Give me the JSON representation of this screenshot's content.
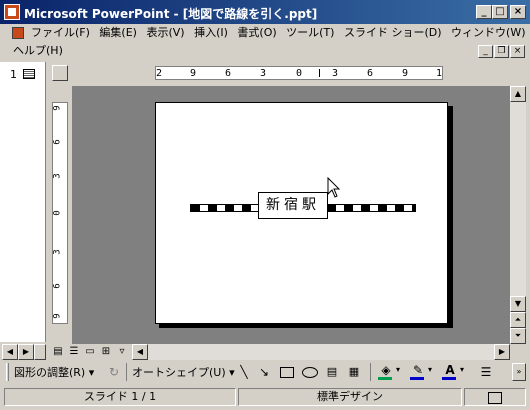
{
  "window": {
    "title": "Microsoft PowerPoint - [地図で路線を引く.ppt]",
    "controls": {
      "minimize": "_",
      "maximize": "□",
      "close": "×"
    }
  },
  "menu": {
    "items": [
      "ファイル(F)",
      "編集(E)",
      "表示(V)",
      "挿入(I)",
      "書式(O)",
      "ツール(T)",
      "スライド ショー(D)",
      "ウィンドウ(W)",
      "ヘルプ(H)"
    ],
    "doc_controls": {
      "minimize": "_",
      "restore": "❐",
      "close": "×"
    }
  },
  "thumbnails": {
    "slide_number": "1"
  },
  "ruler": {
    "horizontal_ticks": [
      "2",
      "9",
      "6",
      "3",
      "0",
      "3",
      "6",
      "9",
      "1"
    ],
    "vertical_ticks": [
      "9",
      "6",
      "3",
      "0",
      "3",
      "6",
      "9"
    ]
  },
  "slide": {
    "station_label": "新宿駅"
  },
  "drawing_toolbar": {
    "adjust_shapes": "図形の調整(R)",
    "autoshapes": "オートシェイプ(U)",
    "fill_color": "#00a050",
    "line_color": "#0000cc",
    "font_color": "#0000cc"
  },
  "status_bar": {
    "slide_indicator": "スライド 1 / 1",
    "design": "標準デザイン"
  }
}
